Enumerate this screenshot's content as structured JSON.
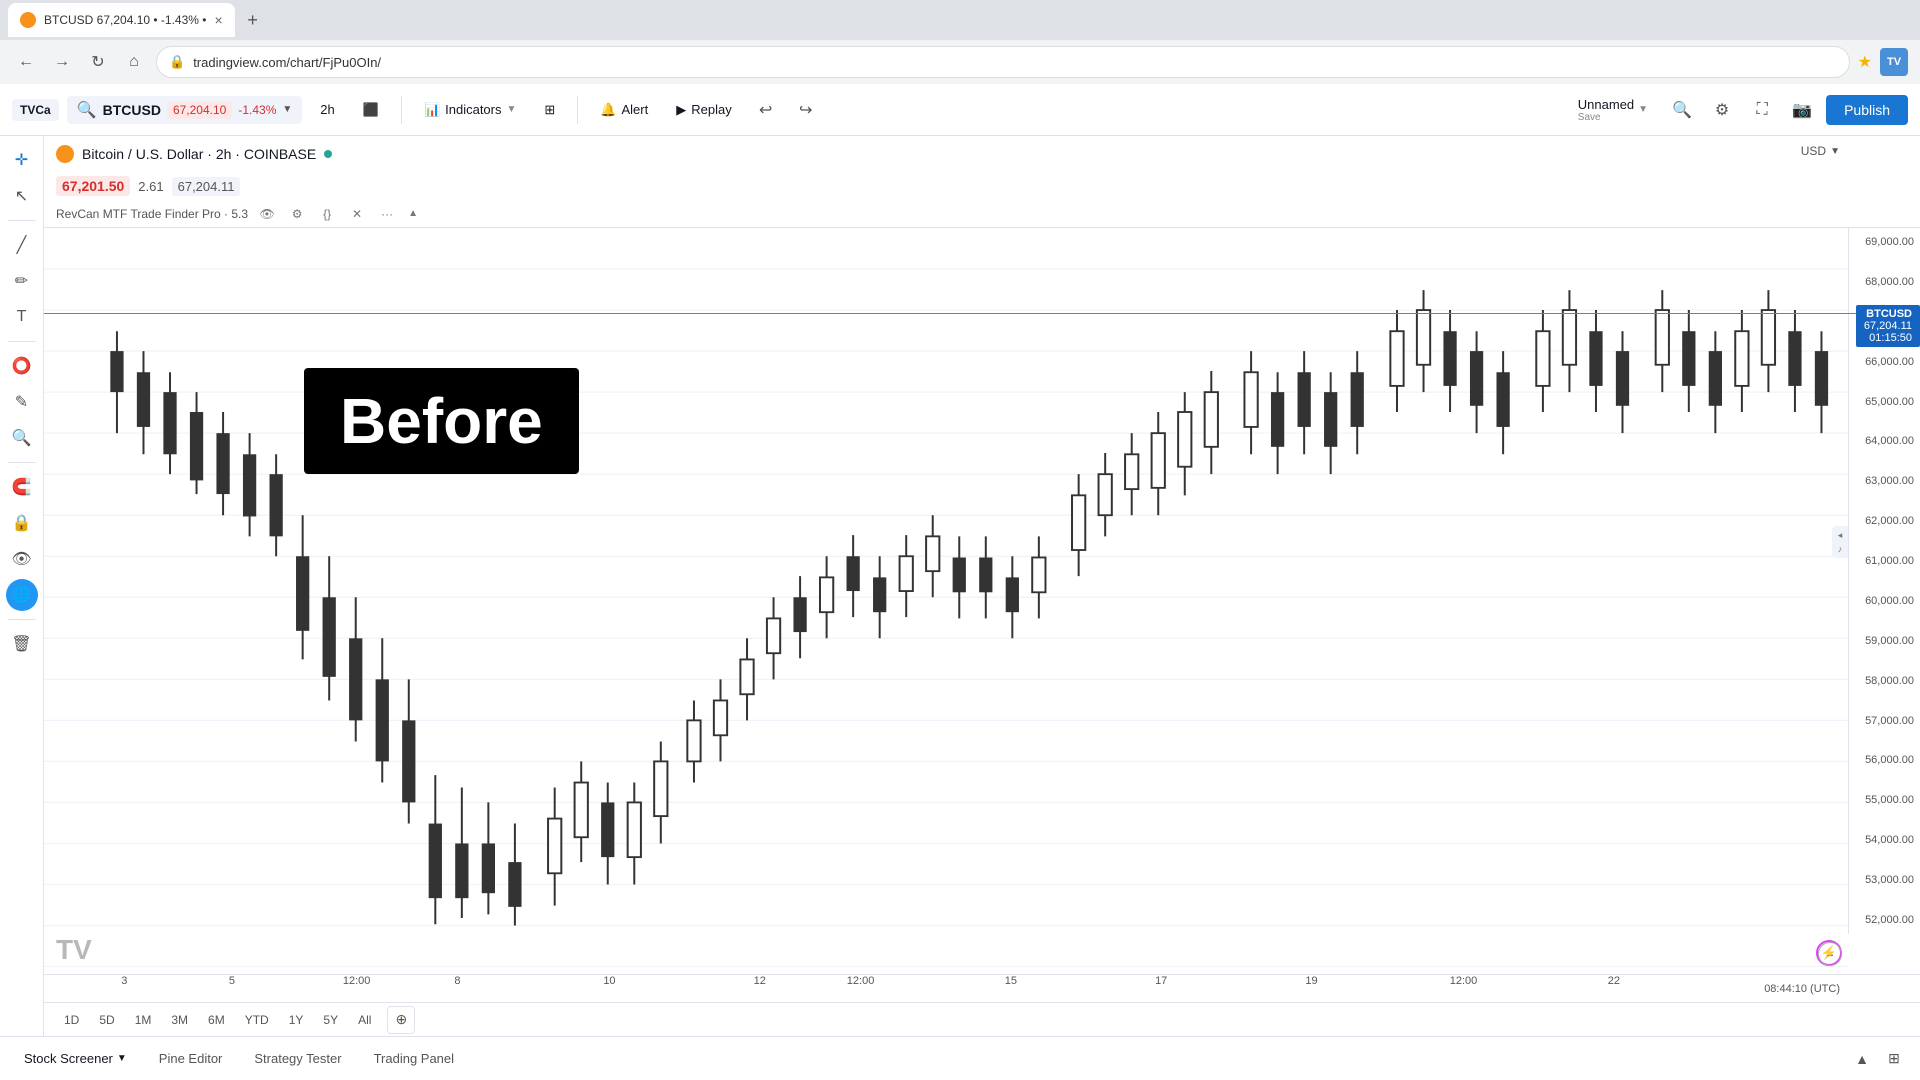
{
  "browser": {
    "tab_favicon": "₿",
    "tab_title": "BTCUSD 67,204.10 • -1.43% •",
    "tab_close": "×",
    "new_tab": "+",
    "nav_back": "←",
    "nav_forward": "→",
    "nav_refresh": "↻",
    "nav_home": "⌂",
    "address_url": "tradingview.com/chart/FjPu0OIn/",
    "star": "★",
    "extension_label": "TV"
  },
  "toolbar": {
    "logo": "TradingView",
    "search_symbol": "BTCUSD",
    "price_badge": "67,204.10",
    "price_change": "-1.43%",
    "interval_label": "2h",
    "bar_style": "⬛",
    "indicators_label": "Indicators",
    "layout_icon": "⊞",
    "alert_label": "Alert",
    "replay_label": "Replay",
    "undo": "↩",
    "redo": "↪",
    "unnamed_label": "Unnamed",
    "unnamed_sub": "Save",
    "search_icon": "🔍",
    "cam_icon": "📷",
    "settings_icon": "⚙",
    "fullscreen_icon": "⛶",
    "publish_label": "Publish"
  },
  "chart_header": {
    "title": "Bitcoin / U.S. Dollar · 2h · COINBASE",
    "status": "live"
  },
  "prices": {
    "current": "67,201.50",
    "change": "2.61",
    "exact": "67,204.11"
  },
  "indicator": {
    "label": "RevCan MTF Trade Finder Pro · 5.3"
  },
  "price_line": {
    "price": "67,204.11",
    "time": "01:15:50",
    "symbol": "BTCUSD"
  },
  "price_scale": {
    "values": [
      "69,000.00",
      "68,000.00",
      "67,000.00",
      "66,000.00",
      "65,000.00",
      "64,000.00",
      "63,000.00",
      "62,000.00",
      "61,000.00",
      "60,000.00",
      "59,000.00",
      "58,000.00",
      "57,000.00",
      "56,000.00",
      "55,000.00",
      "54,000.00",
      "53,000.00",
      "52,000.00"
    ]
  },
  "x_axis": {
    "labels": [
      {
        "pos": 6,
        "label": "3"
      },
      {
        "pos": 14,
        "label": "5"
      },
      {
        "pos": 24,
        "label": "12:00"
      },
      {
        "pos": 32,
        "label": "8"
      },
      {
        "pos": 42,
        "label": "10"
      },
      {
        "pos": 52,
        "label": "12"
      },
      {
        "pos": 60,
        "label": "12:00"
      },
      {
        "pos": 68,
        "label": "15"
      },
      {
        "pos": 78,
        "label": "17"
      },
      {
        "pos": 88,
        "label": "19"
      },
      {
        "pos": 96,
        "label": "12:00"
      },
      {
        "pos": 104,
        "label": "22"
      }
    ],
    "time": "08:44:10 (UTC)"
  },
  "time_range": {
    "buttons": [
      "1D",
      "5D",
      "1M",
      "3M",
      "6M",
      "YTD",
      "1Y",
      "5Y",
      "All"
    ]
  },
  "before_overlay": {
    "text": "Before"
  },
  "bottom_tabs": {
    "stock_screener": "Stock Screener",
    "pine_editor": "Pine Editor",
    "strategy_tester": "Strategy Tester",
    "trading_panel": "Trading Panel"
  },
  "left_sidebar": {
    "icons": [
      "✛",
      "↖",
      "✏",
      "📝",
      "✎",
      "🔍",
      "⭕",
      "✎",
      "🔍",
      "🌐",
      "🗑"
    ]
  },
  "watermark": "TV",
  "chart_time_display": "08:44:10 (UTC)",
  "currency_label": "USD"
}
